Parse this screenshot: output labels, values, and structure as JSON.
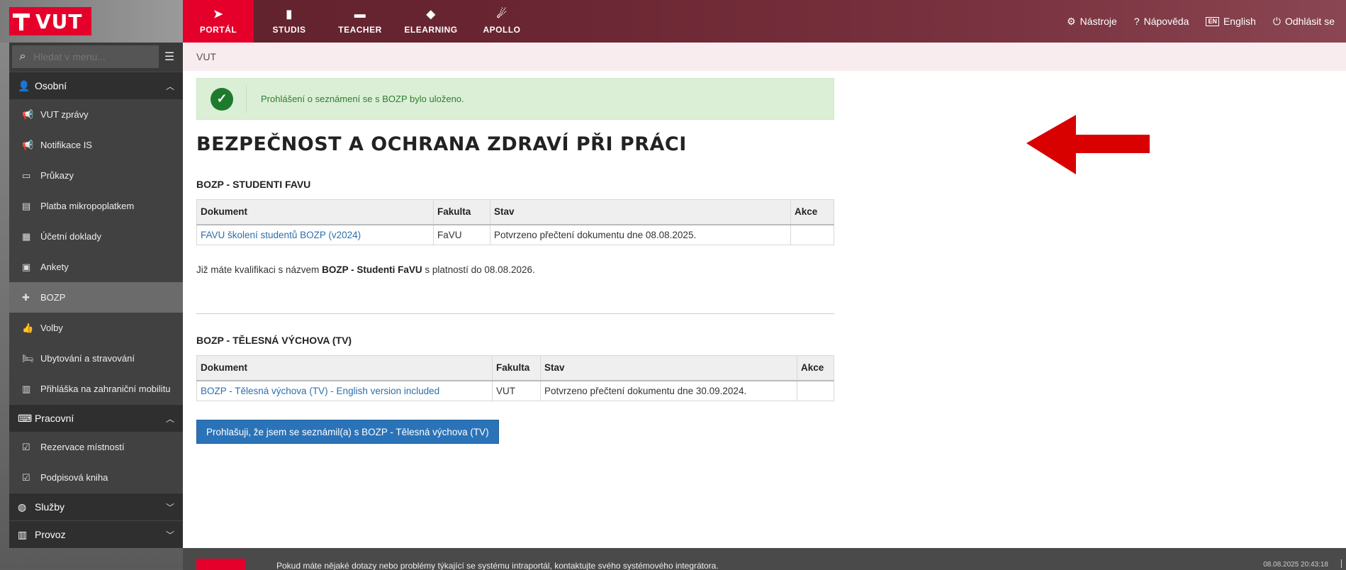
{
  "brand": {
    "logo_text": "VUT"
  },
  "nav": [
    {
      "label": "PORTÁL",
      "icon": "paper-plane-icon"
    },
    {
      "label": "STUDIS",
      "icon": "book-icon"
    },
    {
      "label": "TEACHER",
      "icon": "briefcase-icon"
    },
    {
      "label": "ELEARNING",
      "icon": "graduation-cap-icon"
    },
    {
      "label": "APOLLO",
      "icon": "flame-icon"
    }
  ],
  "top_right": {
    "tools": "Nástroje",
    "help": "Nápověda",
    "lang_badge": "EN",
    "lang": "English",
    "logout": "Odhlásit se"
  },
  "search": {
    "placeholder": "Hledat v menu..."
  },
  "sidebar": {
    "sections": [
      {
        "label": "Osobní"
      },
      {
        "label": "Pracovní"
      },
      {
        "label": "Služby"
      },
      {
        "label": "Provoz"
      }
    ],
    "osobni_items": [
      {
        "label": "VUT zprávy"
      },
      {
        "label": "Notifikace IS"
      },
      {
        "label": "Průkazy"
      },
      {
        "label": "Platba mikropoplatkem"
      },
      {
        "label": "Účetní doklady"
      },
      {
        "label": "Ankety"
      },
      {
        "label": "BOZP"
      },
      {
        "label": "Volby"
      },
      {
        "label": "Ubytování a stravování"
      },
      {
        "label": "Přihláška na zahraniční mobilitu"
      }
    ],
    "pracovni_items": [
      {
        "label": "Rezervace místností"
      },
      {
        "label": "Podpisová kniha"
      }
    ]
  },
  "breadcrumb": "VUT",
  "alert": {
    "message": "Prohlášení o seznámení se s BOZP bylo uloženo."
  },
  "page_title": "BEZPEČNOST A OCHRANA ZDRAVÍ PŘI PRÁCI",
  "section1": {
    "title": "BOZP - STUDENTI FAVU",
    "headers": [
      "Dokument",
      "Fakulta",
      "Stav",
      "Akce"
    ],
    "rows": [
      {
        "document": "FAVU školení studentů BOZP (v2024)",
        "faculty": "FaVU",
        "status": "Potvrzeno přečtení dokumentu dne 08.08.2025.",
        "action": ""
      }
    ],
    "qualification": {
      "prefix": "Již máte kvalifikaci s názvem",
      "name": "BOZP - Studenti FaVU",
      "suffix": "s platností do 08.08.2026."
    }
  },
  "section2": {
    "title": "BOZP - TĚLESNÁ VÝCHOVA (TV)",
    "headers": [
      "Dokument",
      "Fakulta",
      "Stav",
      "Akce"
    ],
    "rows": [
      {
        "document": "BOZP - Tělesná výchova (TV) - English version included",
        "faculty": "VUT",
        "status": "Potvrzeno přečtení dokumentu dne 30.09.2024.",
        "action": ""
      }
    ],
    "button": "Prohlašuji, že jsem se seznámil(a) s BOZP - Tělesná výchova (TV)"
  },
  "footer": {
    "message": "Pokud máte nějaké dotazy nebo problémy týkající se systému intraportál, kontaktujte svého systémového integrátora.",
    "timestamp": "08.08.2025 20:43:18"
  },
  "colors": {
    "accent": "#e4002b",
    "link": "#2c6fad",
    "success_bg": "#dbefd6",
    "button": "#2b73b8"
  }
}
